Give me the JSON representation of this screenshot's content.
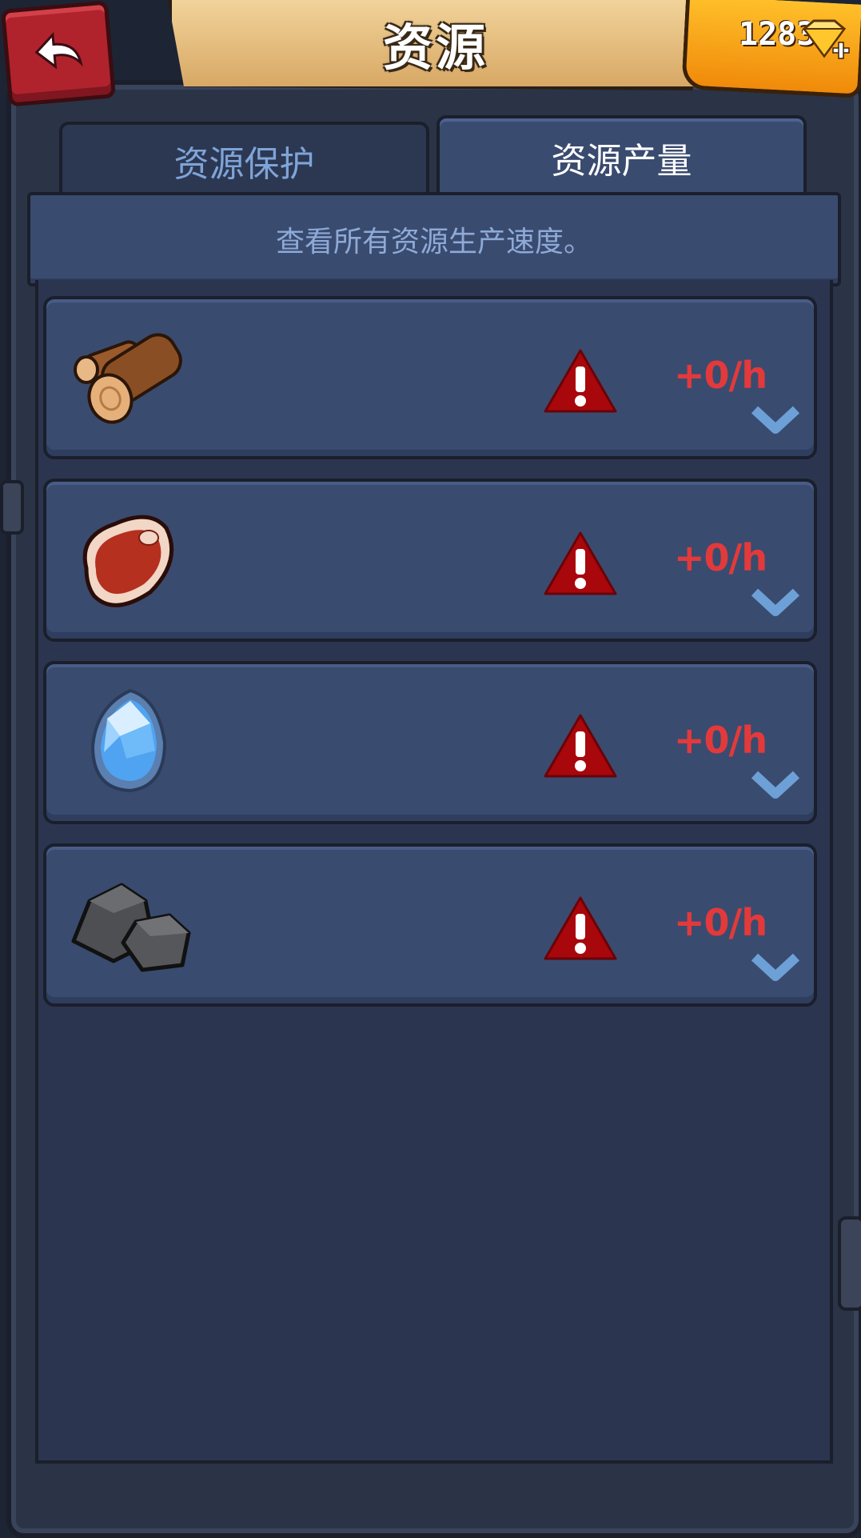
{
  "header": {
    "title": "资源",
    "gem_count": "1283"
  },
  "tabs": [
    {
      "label": "资源保护",
      "active": false
    },
    {
      "label": "资源产量",
      "active": true
    }
  ],
  "description": "查看所有资源生产速度。",
  "resources": [
    {
      "icon": "wood-log-icon",
      "rate": "+0/h"
    },
    {
      "icon": "meat-steak-icon",
      "rate": "+0/h"
    },
    {
      "icon": "crystal-icon",
      "rate": "+0/h"
    },
    {
      "icon": "stone-icon",
      "rate": "+0/h"
    }
  ],
  "colors": {
    "rate_text": "#e23a3a",
    "warning": "#a8070c",
    "tab_active_text": "#ffffff",
    "tab_inactive_text": "#7fa4d8",
    "row_bg": "#3a4b70"
  }
}
